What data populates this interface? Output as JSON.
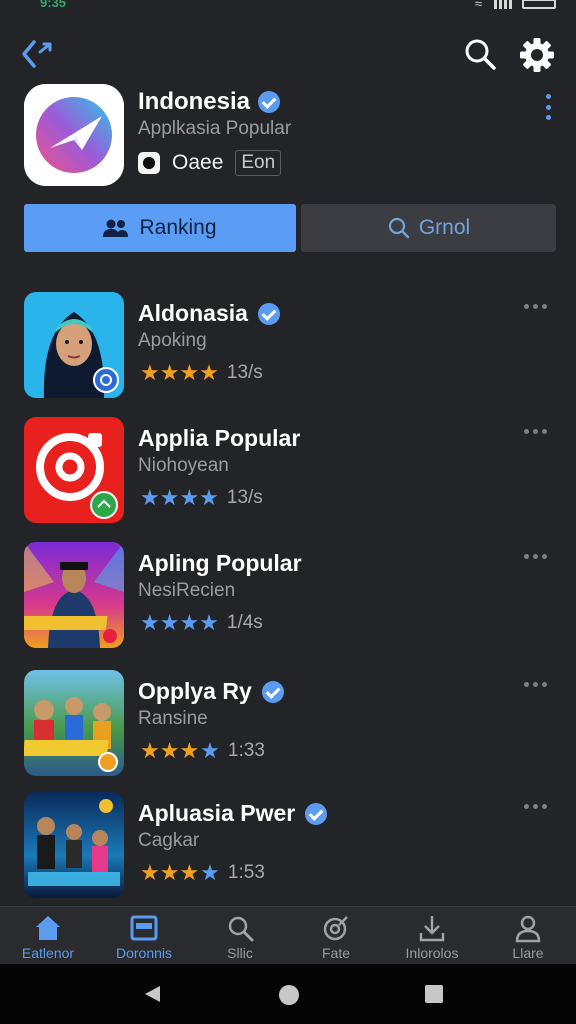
{
  "status_bar": {
    "time": "9:35"
  },
  "header": {
    "title": "Indonesia",
    "subtitle": "Applkasia Popular",
    "meta_text": "Oaee",
    "meta_badge": "Eon"
  },
  "segments": {
    "ranking_label": "Ranking",
    "grnol_label": "Grnol"
  },
  "apps": [
    {
      "name": "Aldonasia",
      "sub": "Apoking",
      "count": "13/s",
      "verified": true,
      "stars": 4,
      "star_color": "#f0a020"
    },
    {
      "name": "Applia Popular",
      "sub": "Niohoyean",
      "count": "13/s",
      "verified": false,
      "stars": 4,
      "star_color": "#5b9cf0"
    },
    {
      "name": "Apling Popular",
      "sub": "NesiRecien",
      "count": "1/4s",
      "verified": false,
      "stars": 3.5,
      "star_color": "#5b9cf0"
    },
    {
      "name": "Opplya Ry",
      "sub": "Ransine",
      "count": "1:33",
      "verified": true,
      "stars": 3.5,
      "star_color": "#f0a020"
    },
    {
      "name": "Apluasia Pwer",
      "sub": "Cagkar",
      "count": "1:53",
      "verified": true,
      "stars": 3.5,
      "star_color": "#f0a020"
    }
  ],
  "bottom_nav": [
    {
      "label": "Eatlenor",
      "icon": "home-icon",
      "active": true
    },
    {
      "label": "Doronnis",
      "icon": "window-icon",
      "active": true
    },
    {
      "label": "Sllic",
      "icon": "search-icon",
      "active": false
    },
    {
      "label": "Fate",
      "icon": "target-icon",
      "active": false
    },
    {
      "label": "Inlorolos",
      "icon": "download-icon",
      "active": false
    },
    {
      "label": "Llare",
      "icon": "person-icon",
      "active": false
    }
  ],
  "colors": {
    "background": "#232427",
    "accent": "#5b9cf5",
    "star_gold": "#f0a020",
    "star_blue": "#5b9cf0"
  }
}
